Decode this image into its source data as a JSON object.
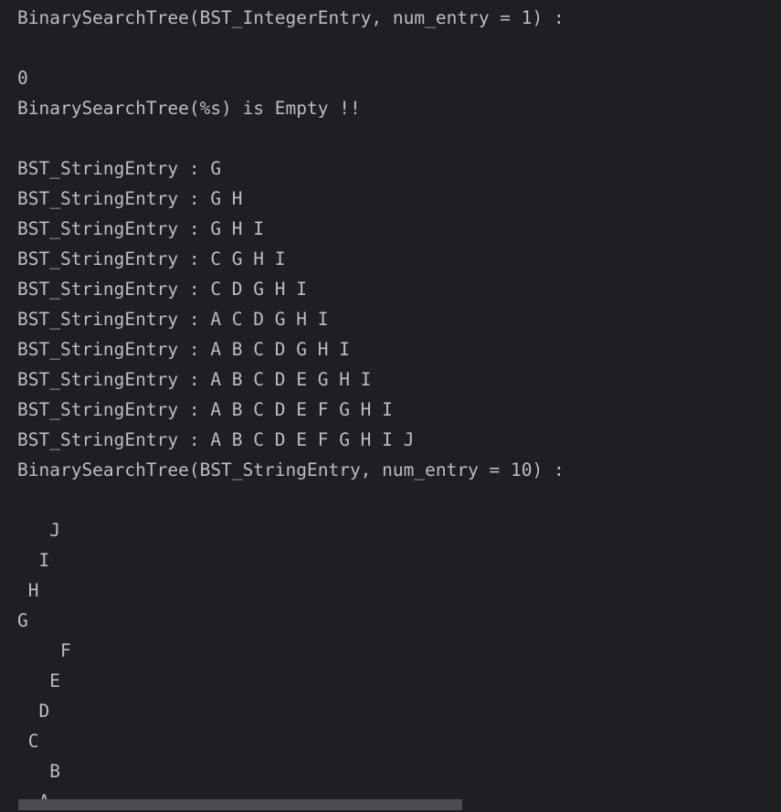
{
  "console": {
    "lines": [
      "BinarySearchTree(BST_IntegerEntry, num_entry = 1) :",
      "",
      "0",
      "BinarySearchTree(%s) is Empty !!",
      "",
      "BST_StringEntry : G",
      "BST_StringEntry : G H",
      "BST_StringEntry : G H I",
      "BST_StringEntry : C G H I",
      "BST_StringEntry : C D G H I",
      "BST_StringEntry : A C D G H I",
      "BST_StringEntry : A B C D G H I",
      "BST_StringEntry : A B C D E G H I",
      "BST_StringEntry : A B C D E F G H I",
      "BST_StringEntry : A B C D E F G H I J",
      "BinarySearchTree(BST_StringEntry, num_entry = 10) :",
      "",
      "   J",
      "  I",
      " H",
      "G",
      "    F",
      "   E",
      "  D",
      " C",
      "   B",
      "  A"
    ]
  }
}
